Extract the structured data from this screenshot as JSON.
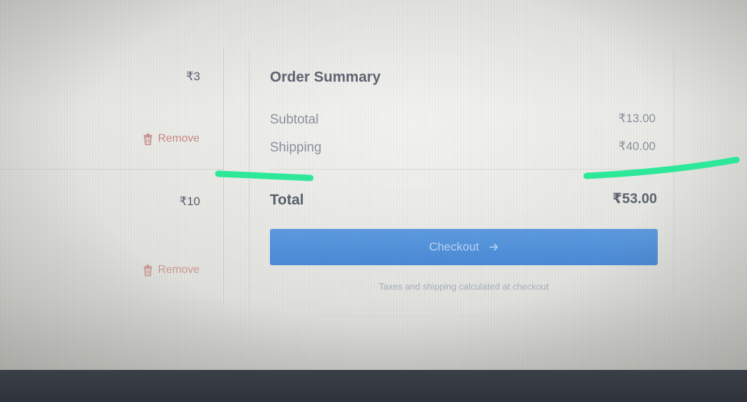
{
  "cart": {
    "items": [
      {
        "price": "₹3",
        "remove_label": "Remove"
      },
      {
        "price": "₹10",
        "remove_label": "Remove"
      }
    ]
  },
  "summary": {
    "title": "Order Summary",
    "subtotal_label": "Subtotal",
    "subtotal_value": "₹13.00",
    "shipping_label": "Shipping",
    "shipping_value": "₹40.00",
    "total_label": "Total",
    "total_value": "₹53.00",
    "checkout_label": "Checkout",
    "note": "Taxes and shipping calculated at checkout"
  },
  "colors": {
    "accent": "#4a8ad6",
    "danger": "#c98b86",
    "marker": "#2ee89a"
  },
  "icons": {
    "remove": "trash-icon",
    "checkout": "arrow-right-icon"
  }
}
